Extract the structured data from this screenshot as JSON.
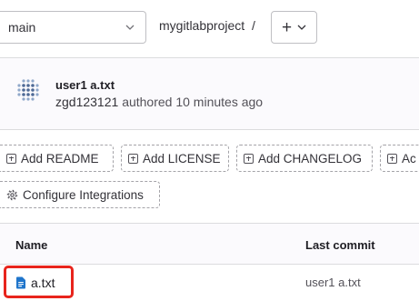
{
  "nav": {
    "branch": "main",
    "project": "mygitlabproject",
    "separator": "/",
    "add_symbol": "+"
  },
  "commit": {
    "title": "user1 a.txt",
    "author": "zgd123121",
    "meta": "authored 10 minutes ago"
  },
  "actions": [
    {
      "label": "Add README",
      "icon": "plus-square-icon"
    },
    {
      "label": "Add LICENSE",
      "icon": "plus-square-icon"
    },
    {
      "label": "Add CHANGELOG",
      "icon": "plus-square-icon"
    },
    {
      "label": "Ac",
      "icon": "plus-square-icon"
    },
    {
      "label": "Configure Integrations",
      "icon": "gear-icon"
    }
  ],
  "table": {
    "headers": {
      "name": "Name",
      "last_commit": "Last commit"
    },
    "rows": [
      {
        "name": "a.txt",
        "last_commit": "user1 a.txt",
        "icon": "file-text-icon"
      }
    ]
  },
  "colors": {
    "highlight": "#e8241c",
    "file_icon": "#1f75cb"
  }
}
